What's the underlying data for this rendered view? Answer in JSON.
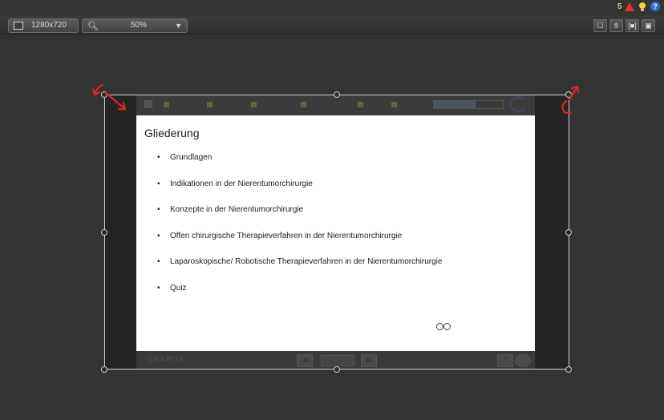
{
  "topbar": {
    "notification_count": "5",
    "icons": [
      "alert-icon",
      "lightbulb-icon",
      "help-icon"
    ],
    "help_glyph": "?"
  },
  "toolbar": {
    "resolution": "1280x720",
    "zoom": "50%",
    "right_buttons": [
      "crop-icon",
      "hand-icon",
      "fit-icon",
      "window-icon"
    ]
  },
  "slide": {
    "title": "Gliederung",
    "bullets": [
      "Grundlagen",
      "Indikationen in der Nierentumorchirurgie",
      "Konzepte in der Nierentumorchirurgie",
      "Offen chirurgische Therapieverfahren in der Nierentumorchirurgie",
      "Laparoskopische/ Robotische Therapieverfahren in der Nierentumorchirurgie",
      "Quiz"
    ],
    "footer_logo": "CHARITÉ",
    "progress": 0.6
  },
  "colors": {
    "background": "#333333",
    "resize_arrows": "#e02424",
    "help_blue": "#2f6fd4"
  }
}
